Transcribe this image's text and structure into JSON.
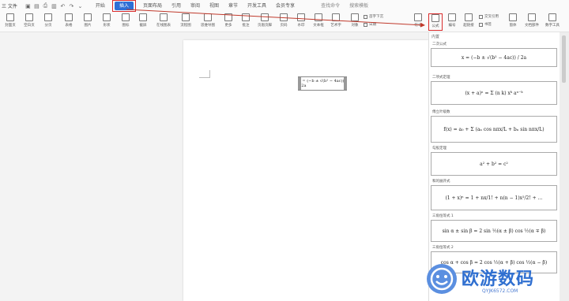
{
  "menubar": {
    "file_label": "三 文件",
    "tabs": [
      "开始",
      "插入",
      "页面布局",
      "引用",
      "审阅",
      "视图",
      "章节",
      "开发工具",
      "会员专享"
    ],
    "active_tab": "插入",
    "search_items": [
      "查找命令",
      "搜索模板"
    ]
  },
  "ribbon": {
    "buttons": [
      "封面页",
      "空白页",
      "分页",
      "表格",
      "图片",
      "形状",
      "图标",
      "截屏",
      "在线图表",
      "流程图",
      "思维导图",
      "更多",
      "批注",
      "页眉页脚",
      "页码",
      "水印",
      "文本框",
      "艺术字",
      "对象",
      "符号",
      "公式",
      "编号",
      "超链接",
      "书签",
      "窗体",
      "文档部件",
      "附件",
      "数字工具"
    ],
    "small_items": [
      "首字下沉",
      "日期",
      "交叉引用"
    ]
  },
  "panel": {
    "header": "内置",
    "equations": [
      {
        "name": "二次公式",
        "formula": "x = (−b ± √(b² − 4ac)) / 2a"
      },
      {
        "name": "二项式定理",
        "formula": "(x + a)ⁿ = Σ (n k) xᵏ aⁿ⁻ᵏ"
      },
      {
        "name": "傅立叶级数",
        "formula": "f(x) = a₀ + Σ (aₙ cos nπx/L + bₙ sin nπx/L)"
      },
      {
        "name": "勾股定理",
        "formula": "a² + b² = c²"
      },
      {
        "name": "和的展开式",
        "formula": "(1 + x)ⁿ = 1 + nx/1! + n(n − 1)x²/2! + …"
      },
      {
        "name": "三角恒等式 1",
        "formula": "sin α ± sin β = 2 sin ½(α ± β) cos ½(α ∓ β)"
      },
      {
        "name": "三角恒等式 2",
        "formula": "cos α + cos β = 2 cos ½(α + β) cos ½(α − β)"
      }
    ]
  },
  "document": {
    "equation": "x = (−b ± √(b² − 4ac)) / 2a"
  },
  "watermark": {
    "title": "欧游数码",
    "subtitle": "QYJK6572.COM"
  }
}
